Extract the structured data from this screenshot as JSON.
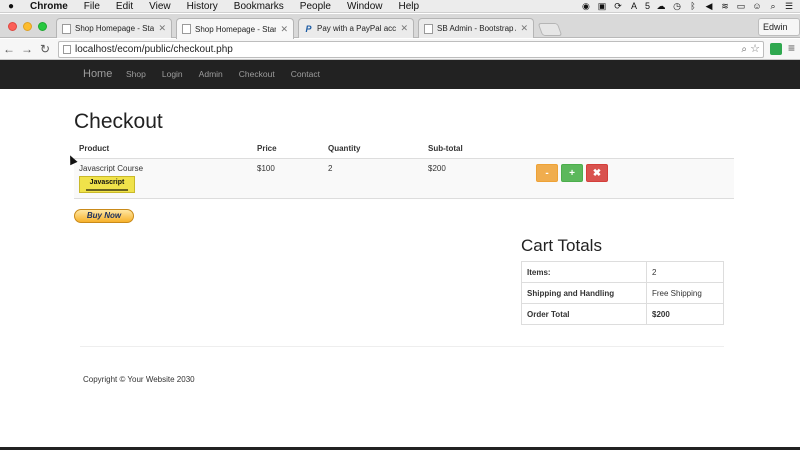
{
  "menubar": {
    "app": "Chrome",
    "items": [
      "File",
      "Edit",
      "View",
      "History",
      "Bookmarks",
      "People",
      "Window",
      "Help"
    ],
    "status_number": "5"
  },
  "browser": {
    "tabs": [
      {
        "title": "Shop Homepage - Start Bo",
        "active": false
      },
      {
        "title": "Shop Homepage - Start Bo",
        "active": true
      },
      {
        "title": "Pay with a PayPal account",
        "active": false
      },
      {
        "title": "SB Admin - Bootstrap Adm",
        "active": false
      }
    ],
    "profile": "Edwin",
    "url": "localhost/ecom/public/checkout.php"
  },
  "navbar": {
    "brand": "Home",
    "links": [
      "Shop",
      "Login",
      "Admin",
      "Checkout",
      "Contact"
    ]
  },
  "checkout": {
    "title": "Checkout",
    "columns": {
      "product": "Product",
      "price": "Price",
      "quantity": "Quantity",
      "subtotal": "Sub-total"
    },
    "items": [
      {
        "product": "Javascript Course",
        "thumb_label": "Javascript",
        "price": "$100",
        "quantity": "2",
        "subtotal": "$200"
      }
    ],
    "action_labels": {
      "decrease": "-",
      "increase": "+",
      "remove": "✖"
    },
    "buy_now_label": "Buy Now"
  },
  "cart_totals": {
    "title": "Cart Totals",
    "rows": [
      {
        "label": "Items:",
        "value": "2"
      },
      {
        "label": "Shipping and Handling",
        "value": "Free Shipping"
      },
      {
        "label": "Order Total",
        "value": "$200"
      }
    ]
  },
  "footer": {
    "copyright": "Copyright © Your Website 2030"
  }
}
